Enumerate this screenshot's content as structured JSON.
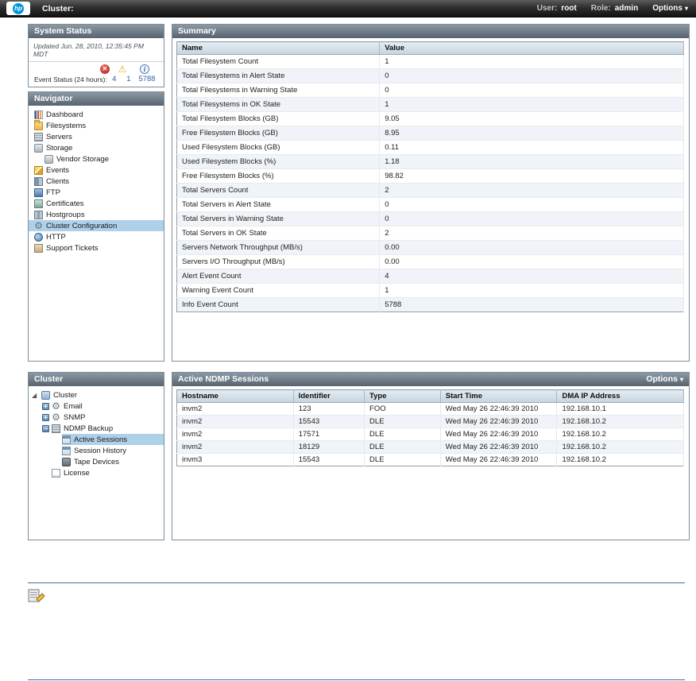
{
  "topbar": {
    "logo_text": "hp",
    "title": "Cluster:",
    "user_label": "User:",
    "user_value": "root",
    "role_label": "Role:",
    "role_value": "admin",
    "options_label": "Options"
  },
  "system_status": {
    "title": "System Status",
    "updated_text": "Updated Jun. 28, 2010, 12:35:45 PM MDT",
    "event_status_label": "Event Status (24 hours):",
    "counts": {
      "alerts": "4",
      "warnings": "1",
      "info": "5788"
    }
  },
  "navigator": {
    "title": "Navigator",
    "items": [
      {
        "label": "Dashboard",
        "icon": "dashboard-icon",
        "indent": 0,
        "selected": false
      },
      {
        "label": "Filesystems",
        "icon": "folder-icon",
        "indent": 0,
        "selected": false
      },
      {
        "label": "Servers",
        "icon": "server-icon",
        "indent": 0,
        "selected": false
      },
      {
        "label": "Storage",
        "icon": "storage-icon",
        "indent": 0,
        "selected": false
      },
      {
        "label": "Vendor Storage",
        "icon": "vendor-storage-icon",
        "indent": 1,
        "selected": false
      },
      {
        "label": "Events",
        "icon": "events-icon",
        "indent": 0,
        "selected": false
      },
      {
        "label": "Clients",
        "icon": "clients-icon",
        "indent": 0,
        "selected": false
      },
      {
        "label": "FTP",
        "icon": "ftp-icon",
        "indent": 0,
        "selected": false
      },
      {
        "label": "Certificates",
        "icon": "certificates-icon",
        "indent": 0,
        "selected": false
      },
      {
        "label": "Hostgroups",
        "icon": "hostgroups-icon",
        "indent": 0,
        "selected": false
      },
      {
        "label": "Cluster Configuration",
        "icon": "gear-icon",
        "indent": 0,
        "selected": true
      },
      {
        "label": "HTTP",
        "icon": "http-icon",
        "indent": 0,
        "selected": false
      },
      {
        "label": "Support Tickets",
        "icon": "tickets-icon",
        "indent": 0,
        "selected": false
      }
    ]
  },
  "summary": {
    "title": "Summary",
    "columns": [
      "Name",
      "Value"
    ],
    "rows": [
      {
        "name": "Total Filesystem Count",
        "value": "1"
      },
      {
        "name": "Total Filesystems in Alert State",
        "value": "0"
      },
      {
        "name": "Total Filesystems in Warning State",
        "value": "0"
      },
      {
        "name": "Total Filesystems in OK State",
        "value": "1"
      },
      {
        "name": "Total Filesystem Blocks (GB)",
        "value": "9.05"
      },
      {
        "name": "Free Filesystem Blocks (GB)",
        "value": "8.95"
      },
      {
        "name": "Used Filesystem Blocks (GB)",
        "value": "0.11"
      },
      {
        "name": "Used Filesystem Blocks (%)",
        "value": "1.18"
      },
      {
        "name": "Free Filesystem Blocks (%)",
        "value": "98.82"
      },
      {
        "name": "Total Servers Count",
        "value": "2"
      },
      {
        "name": "Total Servers in Alert State",
        "value": "0"
      },
      {
        "name": "Total Servers in Warning State",
        "value": "0"
      },
      {
        "name": "Total Servers in OK State",
        "value": "2"
      },
      {
        "name": "Servers Network Throughput (MB/s)",
        "value": "0.00"
      },
      {
        "name": "Servers I/O Throughput (MB/s)",
        "value": "0.00"
      },
      {
        "name": "Alert Event Count",
        "value": "4"
      },
      {
        "name": "Warning Event Count",
        "value": "1"
      },
      {
        "name": "Info Event Count",
        "value": "5788"
      }
    ]
  },
  "cluster_panel": {
    "title": "Cluster",
    "tree": [
      {
        "label": "Cluster",
        "level": 0,
        "expander": "open",
        "icon": "cluster-icon",
        "selected": false
      },
      {
        "label": "Email",
        "level": 1,
        "expander": "plus",
        "icon": "gear-icon",
        "selected": false
      },
      {
        "label": "SNMP",
        "level": 1,
        "expander": "plus",
        "icon": "gear-icon",
        "selected": false
      },
      {
        "label": "NDMP Backup",
        "level": 1,
        "expander": "minus",
        "icon": "ndmp-icon",
        "selected": false
      },
      {
        "label": "Active Sessions",
        "level": 2,
        "expander": null,
        "icon": "table-icon",
        "selected": true
      },
      {
        "label": "Session History",
        "level": 2,
        "expander": null,
        "icon": "table-icon",
        "selected": false
      },
      {
        "label": "Tape Devices",
        "level": 2,
        "expander": null,
        "icon": "tape-icon",
        "selected": false
      },
      {
        "label": "License",
        "level": 1,
        "expander": null,
        "icon": "license-icon",
        "selected": false
      }
    ]
  },
  "ndmp": {
    "title": "Active NDMP Sessions",
    "options_label": "Options",
    "columns": [
      "Hostname",
      "Identifier",
      "Type",
      "Start Time",
      "DMA IP Address"
    ],
    "rows": [
      [
        "invm2",
        "123",
        "FOO",
        "Wed May 26 22:46:39 2010",
        "192.168.10.1"
      ],
      [
        "invm2",
        "15543",
        "DLE",
        "Wed May 26 22:46:39 2010",
        "192.168.10.2"
      ],
      [
        "invm2",
        "17571",
        "DLE",
        "Wed May 26 22:46:39 2010",
        "192.168.10.2"
      ],
      [
        "invm2",
        "18129",
        "DLE",
        "Wed May 26 22:46:39 2010",
        "192.168.10.2"
      ],
      [
        "invm3",
        "15543",
        "DLE",
        "Wed May 26 22:46:39 2010",
        "192.168.10.2"
      ]
    ]
  },
  "colors": {
    "hp_brand_blue": "#0096d6",
    "selection_highlight": "#aed0e8",
    "alert_red": "#b51f1f",
    "warning_yellow": "#e8b10f",
    "info_blue": "#2e5fa3",
    "doc_rule_blue": "#3a72a8"
  }
}
